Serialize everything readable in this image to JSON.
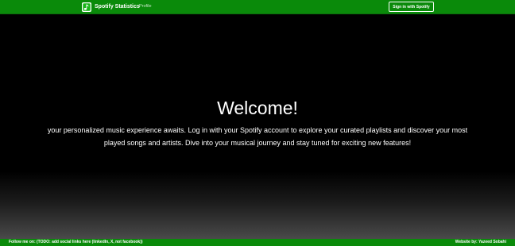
{
  "navbar": {
    "brand_name": "Spotify Statistics",
    "brand_icon": "spotify-logo-icon",
    "profile_link": "Profile",
    "signin_label": "Sign in with Spotify"
  },
  "main": {
    "heading": "Welcome!",
    "intro_text": "your personalized music experience awaits. Log in with your Spotify account to explore your curated playlists and discover your most played songs and artists. Dive into your musical journey and stay tuned for exciting new features!"
  },
  "footer": {
    "follow_text": "Follow me on: (TODO: add social links here (linkedIn, X, not facebook))",
    "website_by": "Website by: Yazeed Sobahi"
  },
  "colors": {
    "brand_green": "#0a8a0a",
    "background": "#000000",
    "text": "#ffffff"
  }
}
